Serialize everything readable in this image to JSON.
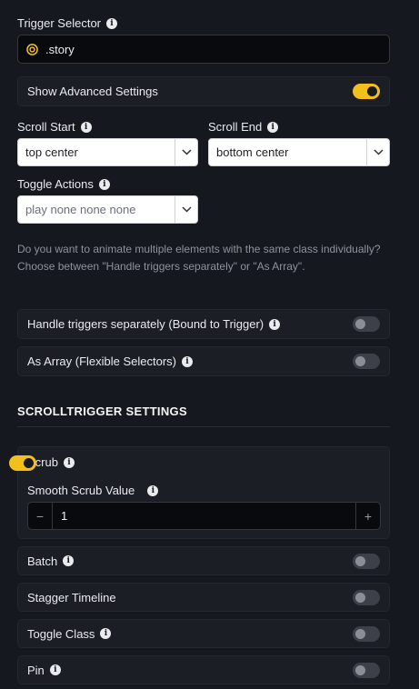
{
  "trigger_selector": {
    "label": "Trigger Selector",
    "value": ".story"
  },
  "advanced": {
    "label": "Show Advanced Settings",
    "on": true
  },
  "scroll_start": {
    "label": "Scroll Start",
    "value": "top center"
  },
  "scroll_end": {
    "label": "Scroll End",
    "value": "bottom center"
  },
  "toggle_actions": {
    "label": "Toggle Actions",
    "value": "play none none none"
  },
  "help_text": "Do you want to animate multiple elements with the same class individually? Choose between \"Handle triggers separately\" or \"As Array\".",
  "handle_triggers": {
    "label": "Handle triggers separately (Bound to Trigger)",
    "on": false
  },
  "as_array": {
    "label": "As Array (Flexible Selectors)",
    "on": false
  },
  "section_title": "SCROLLTRIGGER SETTINGS",
  "scrub": {
    "label": "Scrub",
    "on": true,
    "smooth_label": "Smooth Scrub Value",
    "smooth_value": "1",
    "minus": "−",
    "plus": "+"
  },
  "batch": {
    "label": "Batch",
    "on": false
  },
  "stagger": {
    "label": "Stagger Timeline",
    "on": false
  },
  "toggle_class": {
    "label": "Toggle Class",
    "on": false
  },
  "pin": {
    "label": "Pin",
    "on": false
  },
  "colors": {
    "accent": "#f2bf1c",
    "background": "#15181f"
  },
  "icons": [
    "info-icon",
    "target-icon",
    "chevron-down-icon"
  ]
}
